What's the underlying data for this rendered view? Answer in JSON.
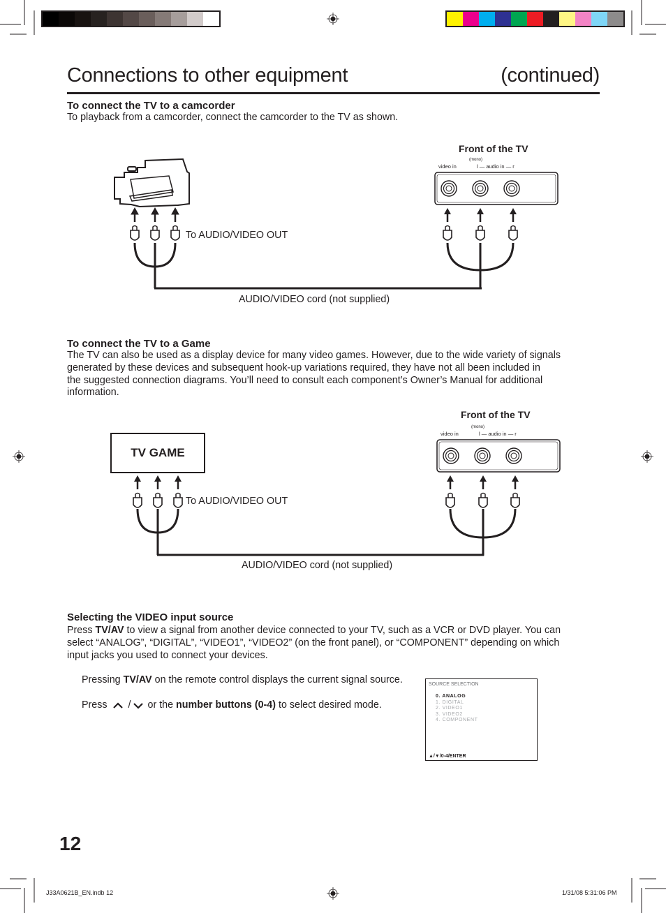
{
  "print_marks": {
    "grayscale_swatches": [
      "#000000",
      "#0b0807",
      "#181311",
      "#272220",
      "#3d3432",
      "#534846",
      "#6a5e5b",
      "#857a77",
      "#a69d9b",
      "#d2cbca",
      "#ffffff"
    ],
    "color_swatches": [
      "#fff200",
      "#ec008c",
      "#00aeef",
      "#2e3192",
      "#00a651",
      "#ed1c24",
      "#231f20",
      "#fff685",
      "#f384c5",
      "#7fd6f7",
      "#8d8b8b"
    ],
    "slug_left": "J33A0621B_EN.indb   12",
    "slug_right": "1/31/08   5:31:06 PM"
  },
  "header": {
    "title": "Connections to other equipment",
    "continued": "(continued)"
  },
  "camcorder_section": {
    "heading": "To connect the TV to a camcorder",
    "body": "To playback from a camcorder, connect the camcorder to the TV as shown.",
    "front_label": "Front of the TV",
    "jack_labels": {
      "video": "video   in",
      "mono": "(mono)",
      "audio": "l — audio   in — r"
    },
    "out_label": "To AUDIO/VIDEO OUT",
    "cord_label": "AUDIO/VIDEO cord (not supplied)"
  },
  "game_section": {
    "heading": "To connect the TV to a Game",
    "body_lines": [
      "The TV can also be used as a display device for many video games. However, due to the wide variety of signals",
      "generated by these devices and subsequent hook-up variations required, they have not all been included in",
      "the suggested connection diagrams. You’ll need to consult each component’s Owner’s Manual for additional",
      "information."
    ],
    "device_label": "TV GAME",
    "front_label": "Front of the TV",
    "jack_labels": {
      "video": "video   in",
      "mono": "(mono)",
      "audio": "l — audio   in — r"
    },
    "out_label": "To AUDIO/VIDEO OUT",
    "cord_label": "AUDIO/VIDEO cord (not supplied)"
  },
  "video_section": {
    "heading": "Selecting the VIDEO input source",
    "body_prefix": "Press ",
    "body_bold": "TV/AV",
    "body_lines": [
      " to view a signal from another device connected to your TV, such as a VCR or DVD player. You can",
      "select “ANALOG”, “DIGITAL”, “VIDEO1”, “VIDEO2” (on the front panel), or “COMPONENT” depending on which",
      "input jacks you used to connect your devices."
    ],
    "step1_prefix": "Pressing ",
    "step1_bold": "TV/AV",
    "step1_suffix": " on the remote control displays the current signal source.",
    "step2_prefix": "Press",
    "step2_sep": "/",
    "step2_mid": " or the ",
    "step2_bold": "number buttons (0-4)",
    "step2_suffix": " to select desired mode."
  },
  "source_menu": {
    "title": "SOURCE SELECTION",
    "items": [
      "0.   ANALOG",
      "1.   DIGITAL",
      "2.   VIDEO1",
      "3.   VIDEO2",
      "4.   COMPONENT"
    ],
    "selected_index": 0,
    "footer": "▲/▼/0-4/ENTER"
  },
  "page_number": "12"
}
